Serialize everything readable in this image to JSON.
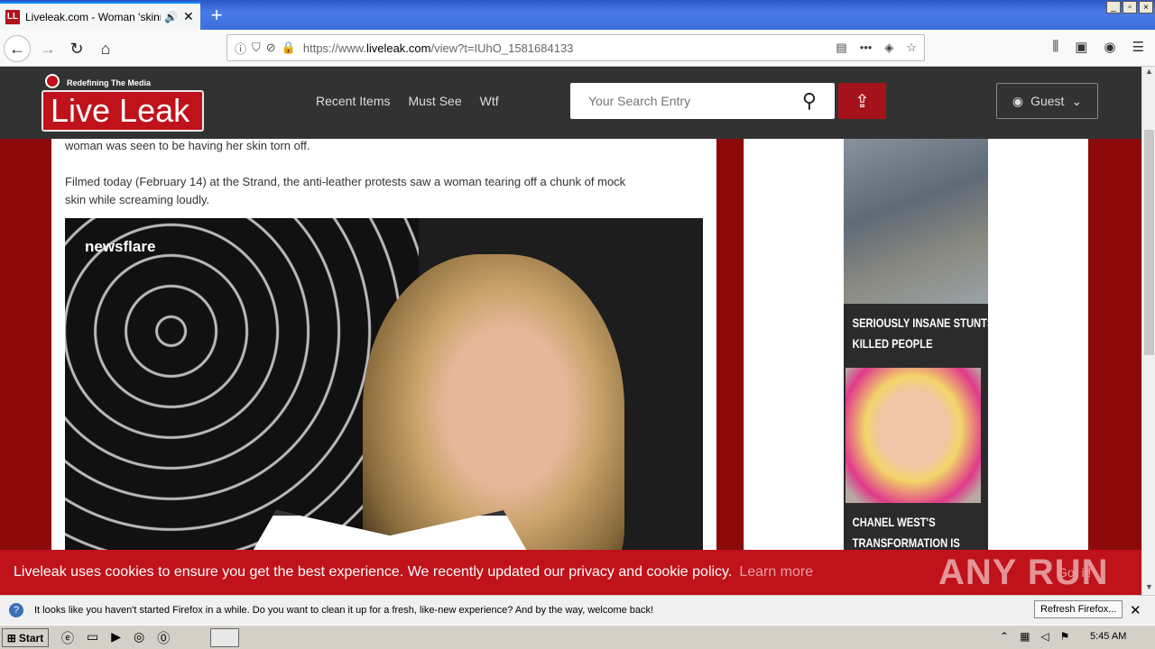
{
  "browser": {
    "tab_title": "Liveleak.com - Woman 'skinned",
    "tab_favicon": "LL",
    "url_domain": "liveleak.com",
    "url_prefix": "https://www.",
    "url_path": "/view?t=IUhO_1581684133",
    "new_tab": "+",
    "win_min": "_",
    "win_max": "▫",
    "win_close": "×"
  },
  "site": {
    "logo_tagline": "Redefining The Media",
    "logo_text": "Live Leak",
    "nav": [
      "Recent Items",
      "Must See",
      "Wtf"
    ],
    "search_placeholder": "Your Search Entry",
    "guest_label": "Guest"
  },
  "article": {
    "line1": "woman was seen to be having her skin torn off.",
    "line2": "Filmed today (February 14) at the Strand, the anti-leather protests saw a woman tearing off a chunk of mock",
    "line3": "skin while screaming loudly.",
    "video_watermark": "newsflare"
  },
  "sidebar": {
    "card1_caption_1": "SERIOUSLY INSANE STUNTS",
    "card1_caption_2": "KILLED PEOPLE",
    "card2_caption_1": "CHANEL WEST'S",
    "card2_caption_2": "TRANSFORMATION IS"
  },
  "cookie": {
    "message": "Liveleak uses cookies to ensure you get the best experience. We recently updated our privacy and cookie policy.",
    "learn_more": "Learn more",
    "got_it": "Got it!",
    "watermark": "ANY RUN"
  },
  "notification": {
    "message": "It looks like you haven't started Firefox in a while. Do you want to clean it up for a fresh, like-new experience? And by the way, welcome back!",
    "button": "Refresh Firefox..."
  },
  "taskbar": {
    "start": "Start",
    "clock": "5:45 AM"
  },
  "colors": {
    "brand_red": "#c0121a",
    "header_dark": "#323232",
    "page_bg": "#8c0a0a"
  }
}
